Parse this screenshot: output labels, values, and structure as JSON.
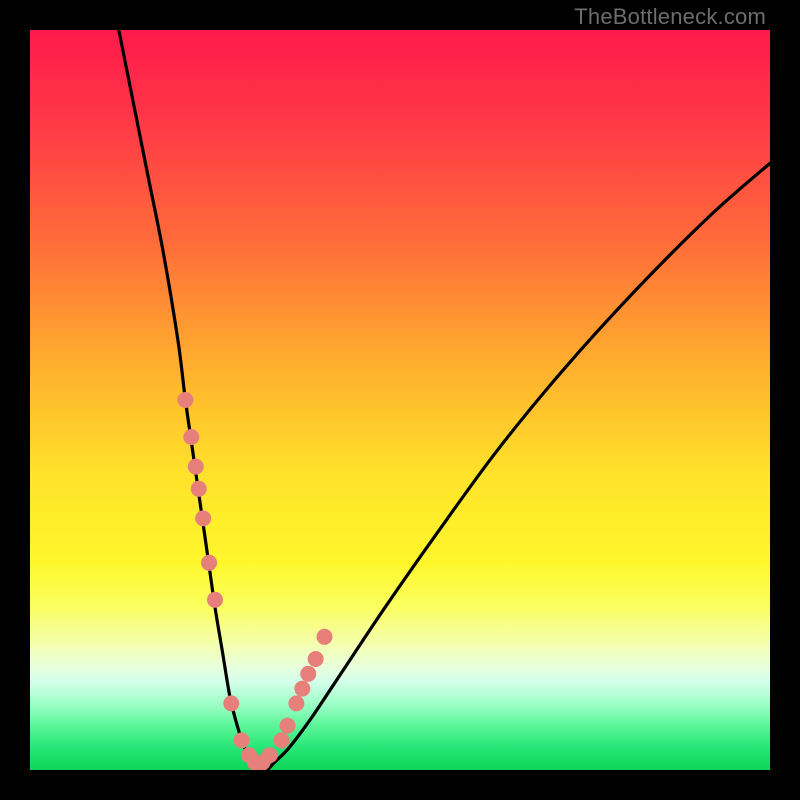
{
  "attribution": "TheBottleneck.com",
  "chart_data": {
    "type": "line",
    "title": "",
    "xlabel": "",
    "ylabel": "",
    "xlim": [
      0,
      100
    ],
    "ylim": [
      0,
      100
    ],
    "gradient_stops": [
      {
        "offset": 0,
        "color": "#ff1a4b"
      },
      {
        "offset": 12,
        "color": "#ff3747"
      },
      {
        "offset": 28,
        "color": "#ff6a3a"
      },
      {
        "offset": 45,
        "color": "#ffae2e"
      },
      {
        "offset": 60,
        "color": "#ffe22a"
      },
      {
        "offset": 72,
        "color": "#fff72b"
      },
      {
        "offset": 78,
        "color": "#fbff61"
      },
      {
        "offset": 83,
        "color": "#f4ffb0"
      },
      {
        "offset": 86,
        "color": "#e9ffdb"
      },
      {
        "offset": 88,
        "color": "#d4ffea"
      },
      {
        "offset": 91,
        "color": "#9fffc8"
      },
      {
        "offset": 94,
        "color": "#5cf59a"
      },
      {
        "offset": 97,
        "color": "#27e676"
      },
      {
        "offset": 100,
        "color": "#0cd657"
      }
    ],
    "series": [
      {
        "name": "bottleneck-curve",
        "x": [
          12,
          14,
          16,
          18,
          20,
          21,
          22,
          23,
          24,
          25,
          26,
          27,
          28,
          29,
          30,
          31,
          32,
          33,
          35,
          38,
          42,
          48,
          55,
          63,
          72,
          82,
          92,
          100
        ],
        "y": [
          100,
          90,
          80,
          70,
          58,
          50,
          43,
          36,
          29,
          22,
          16,
          10,
          6,
          3,
          1,
          0,
          0,
          1,
          3,
          7,
          13,
          22,
          32,
          43,
          54,
          65,
          75,
          82
        ]
      }
    ],
    "markers": {
      "name": "sample-points",
      "x": [
        21.0,
        21.8,
        22.4,
        22.8,
        23.4,
        24.2,
        25.0,
        27.2,
        28.6,
        29.6,
        30.4,
        31.4,
        32.4,
        34.0,
        34.8,
        36.0,
        36.8,
        37.6,
        38.6,
        39.8
      ],
      "y": [
        50,
        45,
        41,
        38,
        34,
        28,
        23,
        9,
        4,
        2,
        1,
        1,
        2,
        4,
        6,
        9,
        11,
        13,
        15,
        18
      ]
    },
    "marker_style": {
      "color": "#e77f7b",
      "radius_px": 8
    }
  }
}
